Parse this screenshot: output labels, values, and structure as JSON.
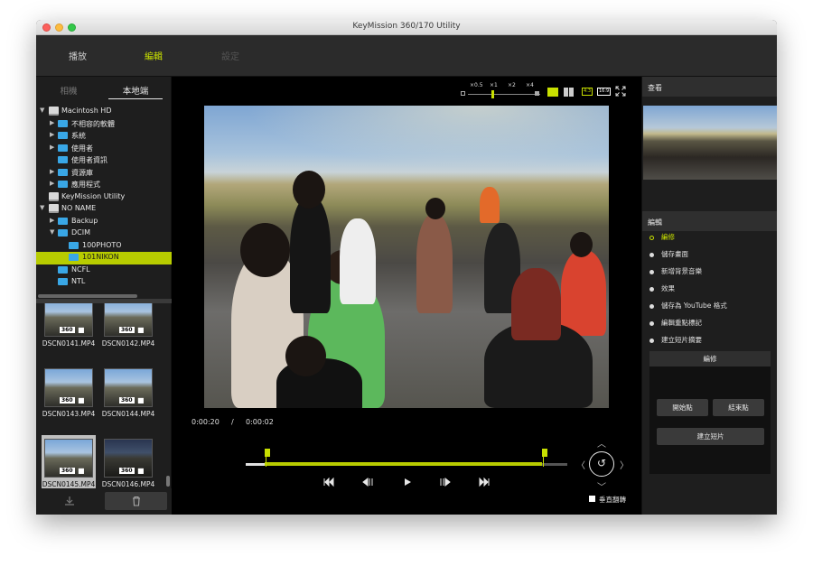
{
  "window": {
    "title": "KeyMission 360/170 Utility"
  },
  "nav": {
    "tabs": [
      {
        "label": "播放"
      },
      {
        "label": "編輯"
      },
      {
        "label": "設定"
      }
    ]
  },
  "source_tabs": {
    "camera": "相機",
    "local": "本地端"
  },
  "tree": [
    {
      "label": "Macintosh HD"
    },
    {
      "label": "不相容的軟體"
    },
    {
      "label": "系統"
    },
    {
      "label": "使用者"
    },
    {
      "label": "使用者資訊"
    },
    {
      "label": "資源庫"
    },
    {
      "label": "應用程式"
    },
    {
      "label": "KeyMission Utility"
    },
    {
      "label": "NO NAME"
    },
    {
      "label": "Backup"
    },
    {
      "label": "DCIM"
    },
    {
      "label": "100PHOTO"
    },
    {
      "label": "101NIKON"
    },
    {
      "label": "NCFL"
    },
    {
      "label": "NTL"
    }
  ],
  "thumbnails": [
    {
      "name": "DSCN0141.MP4",
      "badge": "360"
    },
    {
      "name": "DSCN0142.MP4",
      "badge": "360"
    },
    {
      "name": "DSCN0143.MP4",
      "badge": "360"
    },
    {
      "name": "DSCN0144.MP4",
      "badge": "360"
    },
    {
      "name": "DSCN0145.MP4",
      "badge": "360"
    },
    {
      "name": "DSCN0146.MP4",
      "badge": "360"
    }
  ],
  "zoom": {
    "levels": [
      "×0.5",
      "×1",
      "×2",
      "×4"
    ],
    "aspect_a": "4:3",
    "aspect_b": "16:9"
  },
  "player": {
    "current_time": "0:00:20",
    "separator": "/",
    "total_time": "0:00:02",
    "trim_start": 0.06,
    "trim_end": 0.92
  },
  "flip": {
    "label": "垂直翻轉"
  },
  "right_panel": {
    "view_header": "查看",
    "edit_header": "編輯",
    "menu": [
      {
        "label": "編修"
      },
      {
        "label": "儲存畫面"
      },
      {
        "label": "新增背景音樂"
      },
      {
        "label": "效果"
      },
      {
        "label": "儲存為 YouTube 格式"
      },
      {
        "label": "編輯重點標記"
      },
      {
        "label": "建立短片摘要"
      }
    ],
    "edit_box": {
      "title": "編修",
      "start_btn": "開始點",
      "end_btn": "結束點",
      "create_btn": "建立短片"
    }
  },
  "colors": {
    "accent": "#c8e000",
    "folder": "#39a7e6",
    "selection": "#b8cc00"
  }
}
